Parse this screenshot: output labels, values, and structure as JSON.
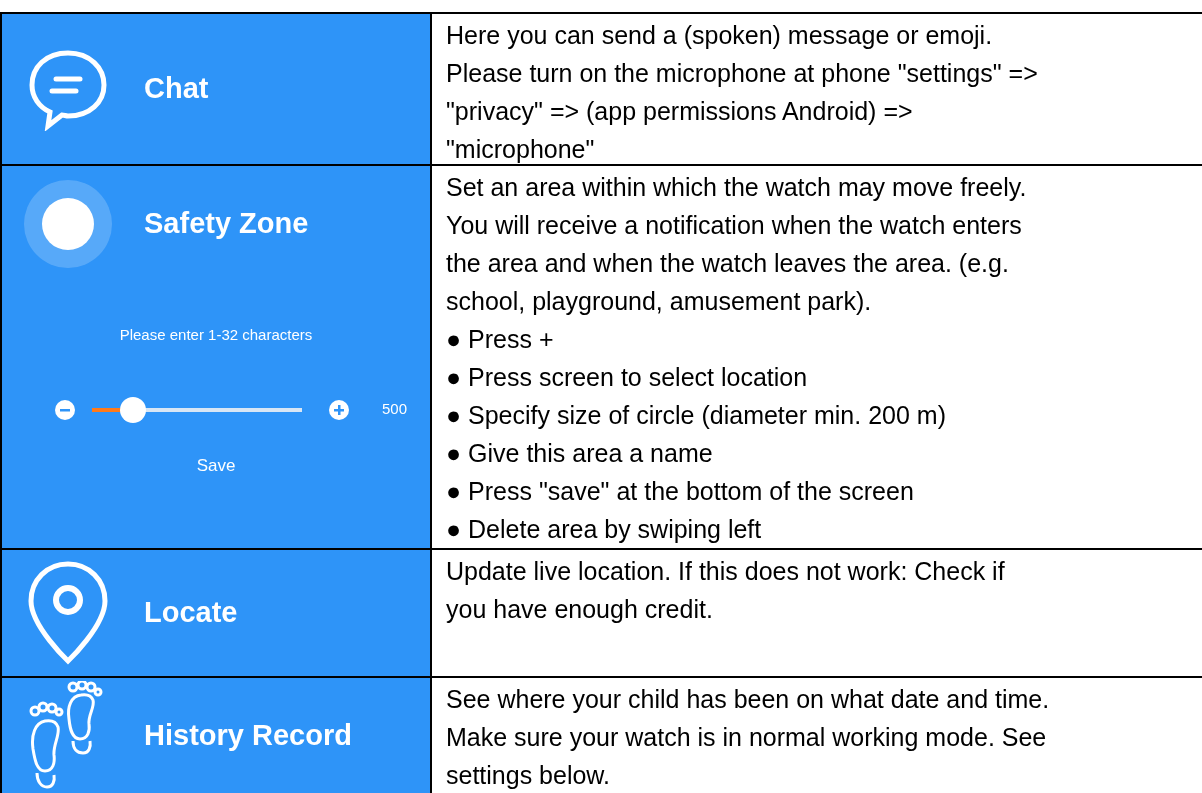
{
  "rows": [
    {
      "kind": "chat",
      "label": "Chat",
      "lines": [
        "Here you can send a (spoken) message or emoji.",
        "Please turn on the microphone at phone \"settings\" =>",
        "\"privacy\" => (app permissions Android) =>",
        "\"microphone\""
      ]
    },
    {
      "kind": "zone",
      "label": "Safety Zone",
      "lines": [
        "Set an area within which the watch may move freely.",
        "You will receive a notification when the watch enters",
        "the area and when the watch leaves the area. (e.g.",
        "school, playground, amusement park).",
        "● Press +",
        "● Press screen to select location",
        "● Specify size of circle (diameter min. 200 m)",
        "● Give this area a name",
        "● Press \"save\" at the bottom of the screen",
        "● Delete area by swiping left"
      ],
      "controls": {
        "placeholder": "Please enter 1-32 characters",
        "level": 0.15,
        "reading": "500",
        "save": "Save"
      }
    },
    {
      "kind": "locate",
      "label": "Locate",
      "lines": [
        "Update live location. If this does not work: Check if",
        "you have enough credit."
      ]
    },
    {
      "kind": "history",
      "label": "History Record",
      "lines": [
        "See where your child has been on what date and time.",
        "Make sure your watch is in normal working mode. See",
        "settings below."
      ]
    }
  ]
}
